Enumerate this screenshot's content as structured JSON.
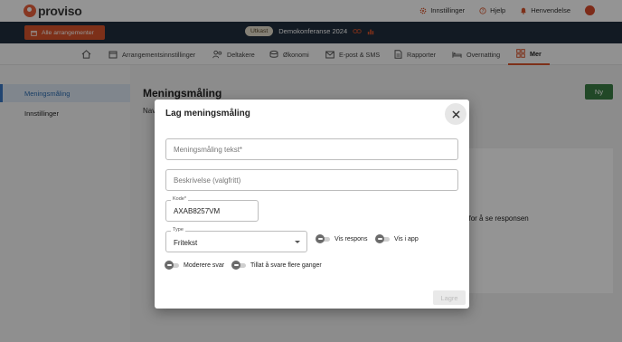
{
  "app": {
    "brand": "proviso"
  },
  "topnav": {
    "settings": "Innstillinger",
    "help": "Hjelp",
    "notifications": "Henvendelse"
  },
  "eventbar": {
    "all_events": "Alle arrangementer",
    "status_badge": "Utkast",
    "event_name": "Demokonferanse 2024"
  },
  "menu": {
    "items": [
      {
        "label": "Arrangementsinnstillinger"
      },
      {
        "label": "Deltakere"
      },
      {
        "label": "Økonomi"
      },
      {
        "label": "E-post & SMS"
      },
      {
        "label": "Rapporter"
      },
      {
        "label": "Overnatting"
      },
      {
        "label": "Mer"
      }
    ]
  },
  "sidebar": {
    "items": [
      {
        "label": "Meningsmåling"
      },
      {
        "label": "Innstillinger"
      }
    ]
  },
  "main": {
    "title": "Meningsmåling",
    "subtitle": "Nav",
    "new_button": "Ny",
    "empty_text": "ingsmåling for å se responsen"
  },
  "modal": {
    "title": "Lag meningsmåling",
    "text_placeholder": "Meningsmåling tekst*",
    "desc_placeholder": "Beskrivelse (valgfritt)",
    "code_label": "Kode*",
    "code_value": "AXAB8257VM",
    "type_label": "Type",
    "type_value": "Fritekst",
    "toggles": {
      "show_response": "Vis respons",
      "show_in_app": "Vis i app",
      "moderate": "Moderere svar",
      "multiple": "Tillat å svare flere ganger"
    },
    "save_label": "Lagre"
  },
  "colors": {
    "brand": "#e8603c",
    "accent": "#d8542b",
    "navy": "#1f2d3d",
    "green": "#3a7d44",
    "sidebar_active": "#dde7f3"
  }
}
